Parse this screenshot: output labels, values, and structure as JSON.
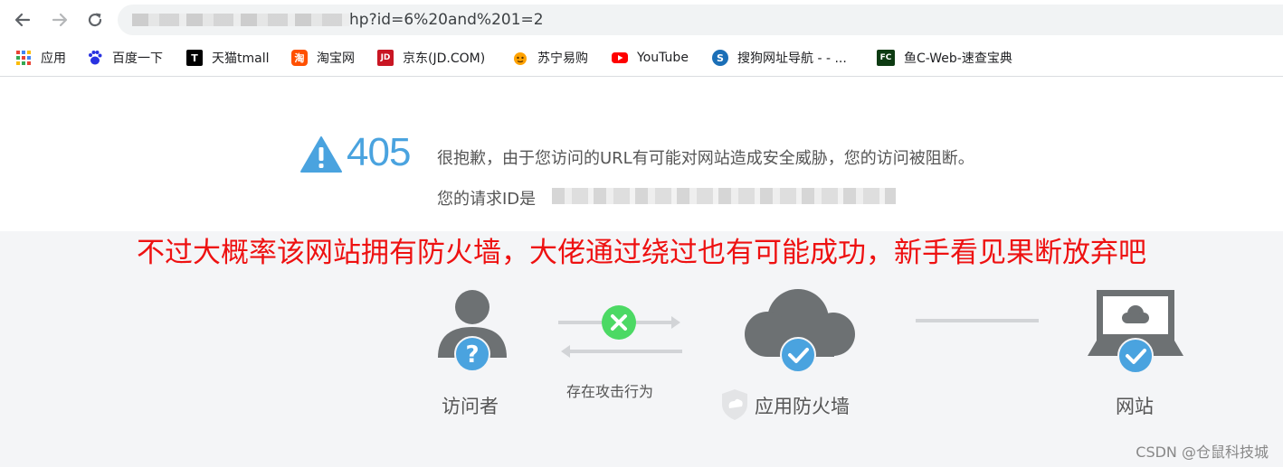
{
  "browser": {
    "url_visible": "hp?id=6%20and%201=2",
    "back_icon": "arrow-left-icon",
    "forward_icon": "arrow-right-icon",
    "reload_icon": "reload-icon"
  },
  "bookmarks": [
    {
      "label": "应用",
      "icon": "apps-grid-icon"
    },
    {
      "label": "百度一下",
      "icon": "baidu-icon"
    },
    {
      "label": "天猫tmall",
      "icon": "tmall-icon",
      "badge": "T"
    },
    {
      "label": "淘宝网",
      "icon": "taobao-icon",
      "badge": "淘"
    },
    {
      "label": "京东(JD.COM)",
      "icon": "jd-icon",
      "badge": "JD"
    },
    {
      "label": "苏宁易购",
      "icon": "suning-icon"
    },
    {
      "label": "YouTube",
      "icon": "youtube-icon"
    },
    {
      "label": "搜狗网址导航 -  - ...",
      "icon": "sogou-icon",
      "badge": "S"
    },
    {
      "label": "鱼C-Web-速查宝典",
      "icon": "fishc-icon",
      "badge": "FC"
    }
  ],
  "error": {
    "code": "405",
    "message": "很抱歉，由于您访问的URL有可能对网站造成安全威胁，您的访问被阻断。",
    "request_id_label": "您的请求ID是"
  },
  "annotation": "不过大概率该网站拥有防火墙，大佬通过绕过也有可能成功，新手看见果断放弃吧",
  "diagram": {
    "visitor_label": "访问者",
    "attack_label": "存在攻击行为",
    "firewall_label": "应用防火墙",
    "website_label": "网站"
  },
  "watermark": "CSDN @仓鼠科技城",
  "colors": {
    "accent_blue": "#4aa3df",
    "error_green": "#4cd964",
    "annotation_red": "#ee1111",
    "icon_gray": "#6d7173"
  }
}
